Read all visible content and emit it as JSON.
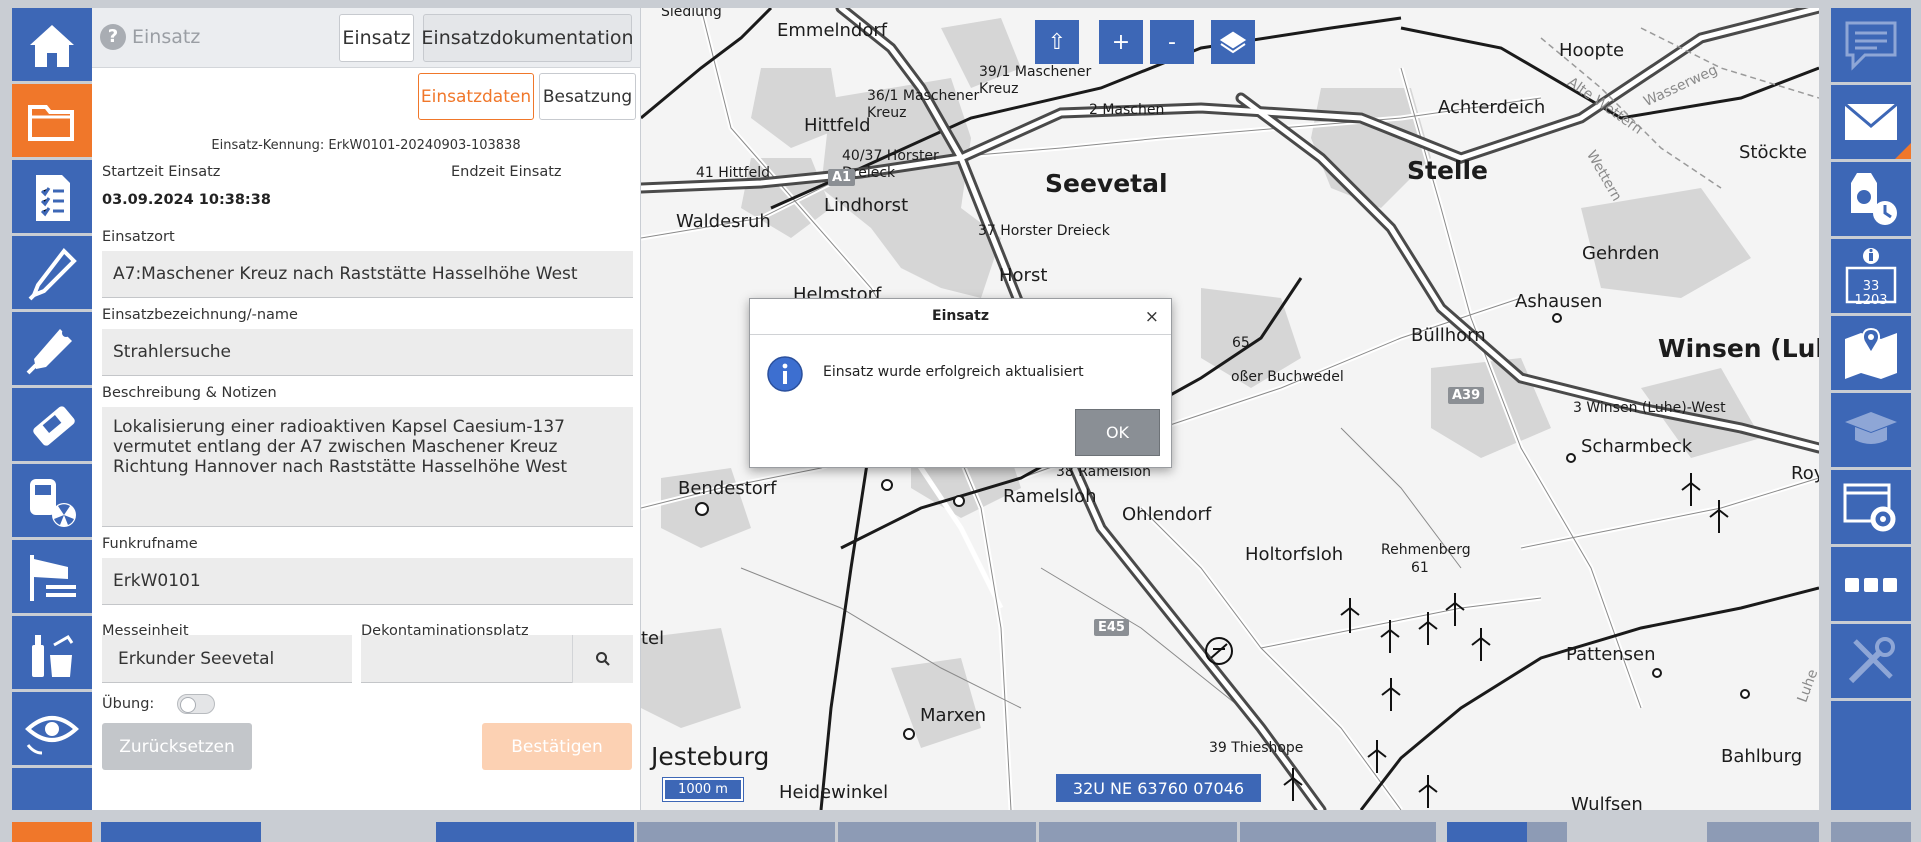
{
  "header": {
    "title": "Einsatz",
    "tabs": [
      "Einsatz",
      "Einsatzdokumentation"
    ],
    "subtabs": [
      "Einsatzdaten",
      "Besatzung"
    ]
  },
  "form": {
    "kennung": "Einsatz-Kennung: ErkW0101-20240903-103838",
    "start_label": "Startzeit Einsatz",
    "end_label": "Endzeit Einsatz",
    "start_value": "03.09.2024 10:38:38",
    "ort_label": "Einsatzort",
    "ort_value": "A7:Maschener Kreuz nach Raststätte Hasselhöhe West",
    "name_label": "Einsatzbezeichnung/-name",
    "name_value": "Strahlersuche",
    "desc_label": "Beschreibung & Notizen",
    "desc_value": "Lokalisierung einer radioaktiven Kapsel Caesium-137\nvermutet entlang der A7 zwischen Maschener Kreuz\nRichtung Hannover nach Raststätte Hasselhöhe West",
    "funk_label": "Funkrufname",
    "funk_value": "ErkW0101",
    "mess_label": "Messeinheit",
    "mess_value": "Erkunder Seevetal",
    "dekon_label": "Dekontaminationsplatz",
    "dekon_value": "",
    "uebung_label": "Übung:",
    "uebung_on": false,
    "reset_label": "Zurücksetzen",
    "confirm_label": "Bestätigen"
  },
  "map": {
    "controls": [
      "⇧",
      "+",
      "-"
    ],
    "places": {
      "seevetal": "Seevetal",
      "stelle": "Stelle",
      "winsen": "Winsen (Luhe)",
      "emmelndorf": "Emmelndorf",
      "siedlung": "Siedlung",
      "hittfeld": "Hittfeld",
      "lindhorst": "Lindhorst",
      "waldesruh": "Waldesruh",
      "horst": "Horst",
      "helmstorf": "Helmstorf",
      "hoopte": "Hoopte",
      "achterdeich": "Achterdeich",
      "stoeckte": "Stöckte",
      "gehrden": "Gehrden",
      "ashausen": "Ashausen",
      "buellhorn": "Büllhorn",
      "scharmbeck": "Scharmbeck",
      "bendestorf": "Bendestorf",
      "ramelsloh": "Ramelsloh",
      "ohlendorf": "Ohlendorf",
      "holtorfsloh": "Holtorfsloh",
      "rehmenberg": "Rehmenberg",
      "rehmenberg_num": "61",
      "pattensen": "Pattensen",
      "marxen": "Marxen",
      "jesteburg": "Jesteburg",
      "heidewinkel": "Heidewinkel",
      "bahlburg": "Bahlburg",
      "wulfsen": "Wulfsen",
      "tel": "tel",
      "buchwedel": "oßer Buchwedel",
      "buchwedel_num": "65",
      "roy": "Roy",
      "alte_wettern": "Alte Wettern",
      "wettern": "Wettern",
      "wasserweg": "Wasserweg",
      "luhe": "Luhe",
      "maschener_kreuz": "39/1 Maschener\nKreuz",
      "maschener_kreuz2": "36/1 Maschener\nKreuz",
      "maschen": "2 Maschen",
      "horster_dreieck": "40/37 Horster\nDreieck",
      "horster_dreieck2": "37 Horster Dreieck",
      "hittfeld_exit": "41 Hittfeld",
      "ramelsloh_exit": "38 Ramelsloh",
      "winsen_west": "3 Winsen (Luhe)-West",
      "thieshope": "39 Thieshope"
    },
    "shields": [
      "A1",
      "A39",
      "E45"
    ],
    "scale": "1000 m",
    "coordinates": "32U NE 63760 07046"
  },
  "dialog": {
    "title": "Einsatz",
    "close": "×",
    "message": "Einsatz wurde erfolgreich aktualisiert",
    "ok_label": "OK"
  },
  "right_rail": {
    "info_line1": "33",
    "info_line2": "1203"
  },
  "colors": {
    "primary": "#3d67b6",
    "accent": "#f0772a",
    "confirm_disabled": "#fcd1b3",
    "reset_disabled": "#c3c6ca"
  }
}
